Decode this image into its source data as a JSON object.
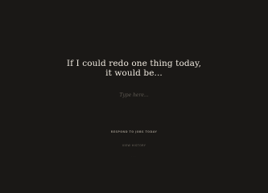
{
  "prompt": {
    "line1": "If I could redo one thing today,",
    "line2": "it would be..."
  },
  "answer": {
    "placeholder": "Type here...",
    "value": ""
  },
  "actions": {
    "submit_label": "RESPOND TO JOBS TODAY",
    "history_label": "VIEW HISTORY",
    "footer_label": "· · ·"
  },
  "colors": {
    "background": "#1a1816",
    "prompt_text": "#efe9df",
    "muted_text": "#8e877d"
  }
}
